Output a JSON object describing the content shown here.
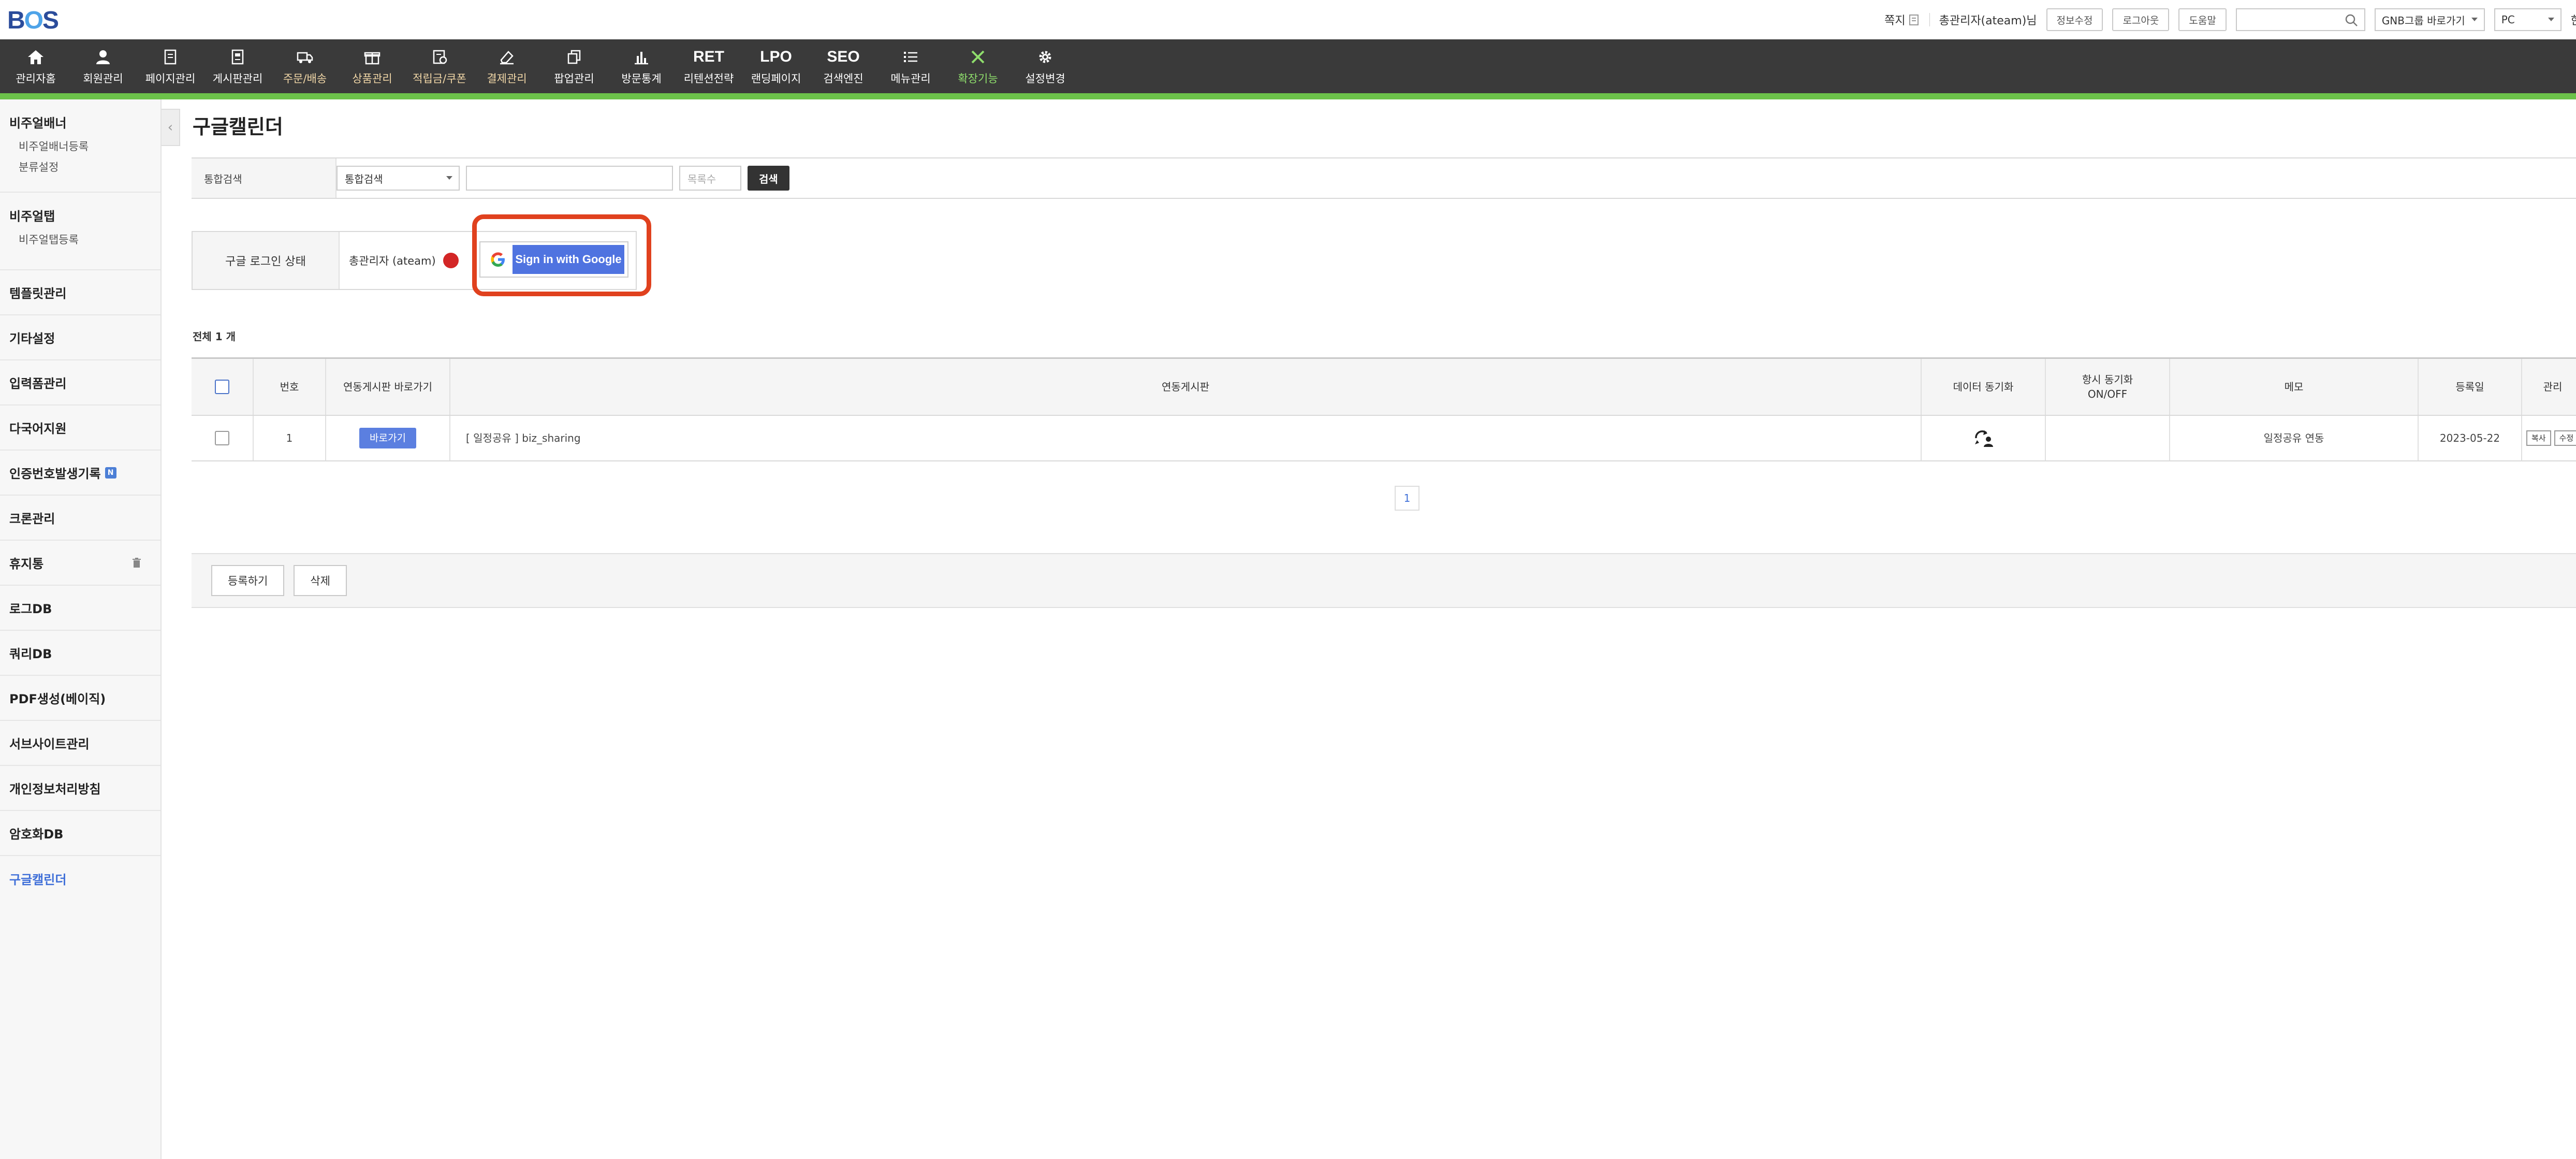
{
  "brand": {
    "logo_b": "B",
    "logo_o": "O",
    "logo_s": "S"
  },
  "topbar": {
    "memo": "쪽지",
    "user": "총관리자(ateam)님",
    "info_btn": "정보수정",
    "logout_btn": "로그아웃",
    "help_btn": "도움말",
    "gnb_shortcut": "GNB그룹 바로가기",
    "device": "PC",
    "overflow_char": "한"
  },
  "gnb": [
    {
      "label": "관리자홈"
    },
    {
      "label": "회원관리"
    },
    {
      "label": "페이지관리"
    },
    {
      "label": "게시판관리"
    },
    {
      "label": "주문/배송"
    },
    {
      "label": "상품관리"
    },
    {
      "label": "적립금/쿠폰"
    },
    {
      "label": "결제관리"
    },
    {
      "label": "팝업관리"
    },
    {
      "label": "방문통계"
    },
    {
      "label": "리텐션전략",
      "text_icon": "RET"
    },
    {
      "label": "랜딩페이지",
      "text_icon": "LPO"
    },
    {
      "label": "검색엔진",
      "text_icon": "SEO"
    },
    {
      "label": "메뉴관리"
    },
    {
      "label": "확장기능"
    },
    {
      "label": "설정변경"
    }
  ],
  "sidebar": {
    "visual_banner": {
      "title": "비주얼배너",
      "items": [
        "비주얼배너등록",
        "분류설정"
      ]
    },
    "visual_tab": {
      "title": "비주얼탭",
      "items": [
        "비주얼탭등록"
      ]
    },
    "singles": [
      "템플릿관리",
      "기타설정",
      "입력폼관리",
      "다국어지원",
      "인증번호발생기록",
      "크론관리",
      "휴지통",
      "로그DB",
      "쿼리DB",
      "PDF생성(베이직)",
      "서브사이트관리",
      "개인정보처리방침",
      "암호화DB",
      "구글캘린더"
    ],
    "new_badge": "N"
  },
  "main": {
    "title": "구글캘린더",
    "search": {
      "label": "통합검색",
      "select_value": "통합검색",
      "keyword_value": "",
      "rows_placeholder": "목록수",
      "button": "검색"
    },
    "login": {
      "label": "구글 로그인 상태",
      "user": "총관리자 (ateam)",
      "google_button": "Sign in with Google"
    },
    "total": "전체 1 개",
    "table": {
      "headers": [
        "번호",
        "연동게시판 바로가기",
        "연동게시판",
        "데이터 동기화",
        "항시 동기화\nON/OFF",
        "메모",
        "등록일",
        "관리"
      ],
      "rows": [
        {
          "no": "1",
          "go": "바로가기",
          "board": "[ 일정공유 ] biz_sharing",
          "sync": "",
          "always": "",
          "memo": "일정공유 연동",
          "date": "2023-05-22",
          "copy": "복사",
          "edit": "수정"
        }
      ]
    },
    "pager": [
      "1"
    ],
    "register_btn": "등록하기",
    "delete_btn": "삭제"
  }
}
